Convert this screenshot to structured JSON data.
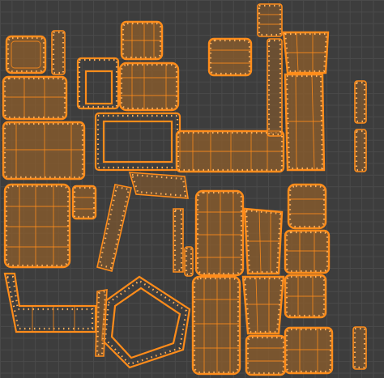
{
  "editor": {
    "background_color": "#3d3d3d",
    "grid_color": "#4a4a4a",
    "selection_color": "#ff8c1a",
    "face_fill_color": "#8a5c2c"
  }
}
